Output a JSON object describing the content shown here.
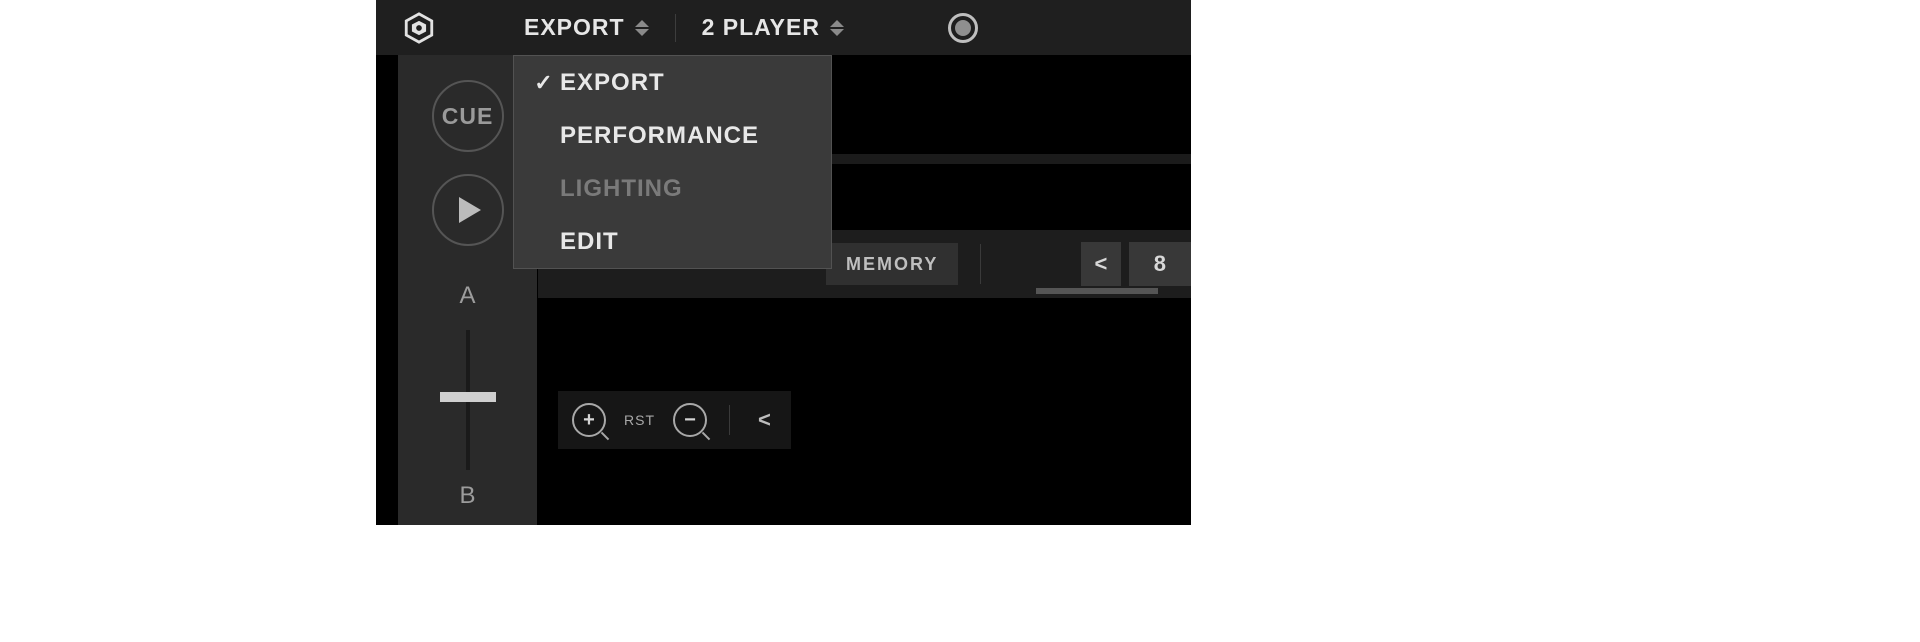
{
  "topbar": {
    "mode_label": "EXPORT",
    "player_label": "2 PLAYER"
  },
  "dropdown": {
    "items": [
      {
        "label": "EXPORT",
        "selected": true,
        "enabled": true
      },
      {
        "label": "PERFORMANCE",
        "selected": false,
        "enabled": true
      },
      {
        "label": "LIGHTING",
        "selected": false,
        "enabled": false
      },
      {
        "label": "EDIT",
        "selected": false,
        "enabled": true
      }
    ]
  },
  "transport": {
    "cue_label": "CUE",
    "deck_a": "A",
    "deck_b": "B"
  },
  "loopbar": {
    "memory_label": "MEMORY",
    "prev_glyph": "<",
    "beat_value": "8"
  },
  "zoom": {
    "plus": "+",
    "minus": "−",
    "reset_label": "RST",
    "prev_glyph": "<"
  }
}
